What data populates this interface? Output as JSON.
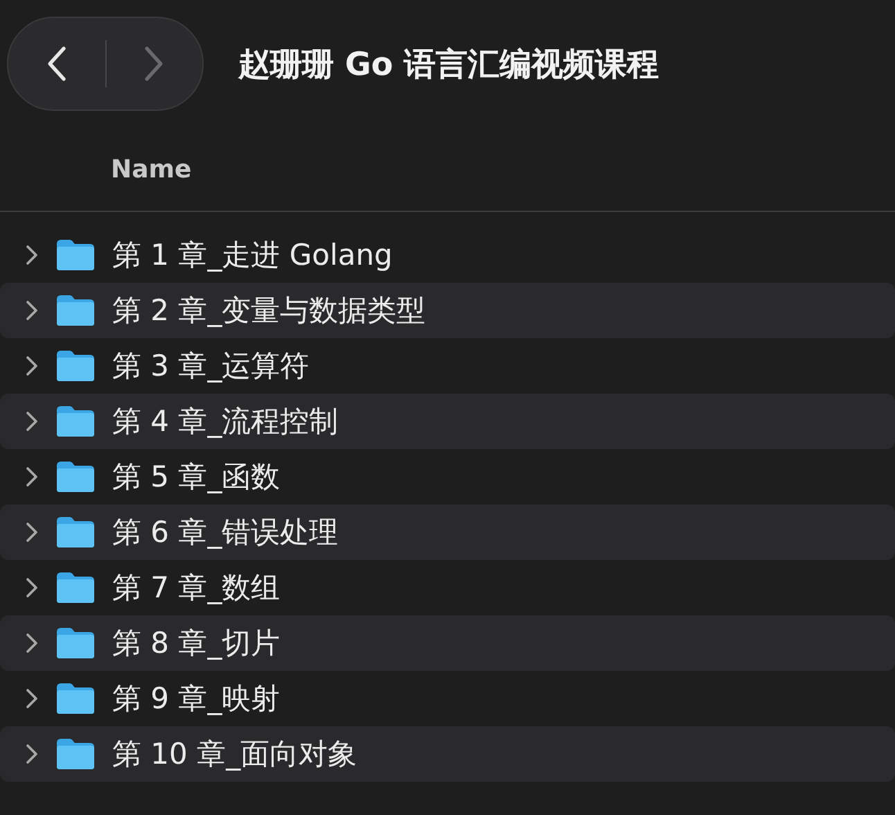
{
  "window": {
    "title": "赵珊珊 Go 语言汇编视频课程"
  },
  "navigation": {
    "back_disabled": false,
    "forward_disabled": true
  },
  "columns": [
    "Name"
  ],
  "rows": [
    {
      "name": "第 1 章_走进 Golang",
      "expanded": false
    },
    {
      "name": "第 2 章_变量与数据类型",
      "expanded": false
    },
    {
      "name": "第 3 章_运算符",
      "expanded": false
    },
    {
      "name": "第 4 章_流程控制",
      "expanded": false
    },
    {
      "name": "第 5 章_函数",
      "expanded": false
    },
    {
      "name": "第 6 章_错误处理",
      "expanded": false
    },
    {
      "name": "第 7 章_数组",
      "expanded": false
    },
    {
      "name": "第 8 章_切片",
      "expanded": false
    },
    {
      "name": "第 9 章_映射",
      "expanded": false
    },
    {
      "name": "第 10 章_面向对象",
      "expanded": false
    }
  ]
}
